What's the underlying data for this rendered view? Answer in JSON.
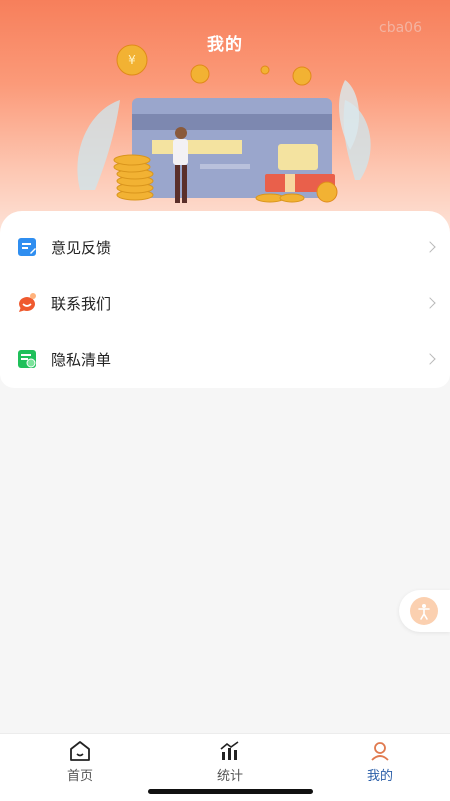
{
  "header": {
    "title": "我的",
    "version": "cba06"
  },
  "menu": {
    "items": [
      {
        "label": "意见反馈",
        "icon": "feedback-icon"
      },
      {
        "label": "联系我们",
        "icon": "contact-icon"
      },
      {
        "label": "隐私清单",
        "icon": "privacy-list-icon"
      }
    ]
  },
  "tabbar": {
    "tabs": [
      {
        "label": "首页",
        "icon": "home-icon",
        "active": false
      },
      {
        "label": "统计",
        "icon": "stats-icon",
        "active": false
      },
      {
        "label": "我的",
        "icon": "profile-icon",
        "active": true
      }
    ]
  },
  "colors": {
    "header_top": "#f77f5b",
    "accent": "#2a5ea8",
    "coin": "#f2b233"
  }
}
